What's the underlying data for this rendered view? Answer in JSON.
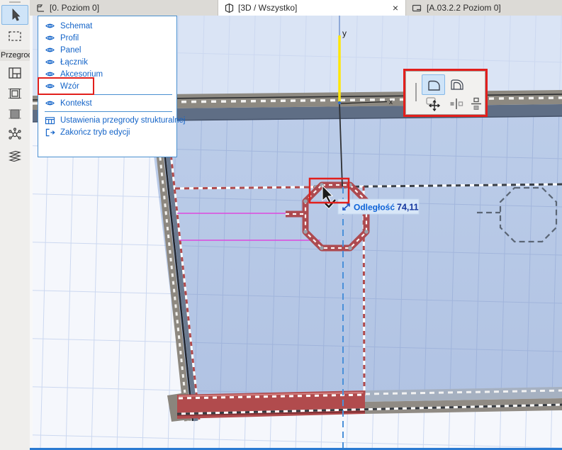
{
  "tabs": {
    "items": [
      {
        "label": "[0. Poziom 0]"
      },
      {
        "label": "[3D / Wszystko]",
        "active": true
      },
      {
        "label": "[A.03.2.2 Poziom 0]"
      }
    ],
    "close_glyph": "×"
  },
  "sidebar": {
    "group_label": "Przegroda",
    "tools": [
      "arrow",
      "marquee",
      "scheme",
      "frame",
      "panel",
      "junction",
      "accessory"
    ]
  },
  "context_menu": {
    "items": [
      {
        "label": "Schemat"
      },
      {
        "label": "Profil"
      },
      {
        "label": "Panel"
      },
      {
        "label": "Łącznik"
      },
      {
        "label": "Akcesorium"
      },
      {
        "label": "Wzór",
        "highlighted": true
      },
      {
        "label": "Kontekst"
      },
      {
        "label": "Ustawienia przegrody strukturalnej"
      },
      {
        "label": "Zakończ tryb edycji"
      }
    ]
  },
  "palette": {
    "buttons": [
      "boundary-simple",
      "boundary-offset",
      "move",
      "offset-edge",
      "distribute"
    ]
  },
  "canvas": {
    "axis_y_label": "y",
    "axis_x_label": "x",
    "tooltip": {
      "label": "Odległość",
      "value": "74,11"
    }
  },
  "colors": {
    "selection_red": "#b04a4c",
    "annotation_red": "#e21f1c",
    "guide_blue": "#4a90d9",
    "axis_yellow": "#ffe70a",
    "magenta": "#de49de",
    "glass": "#b5c7e6",
    "menu_text": "#1464c8"
  }
}
